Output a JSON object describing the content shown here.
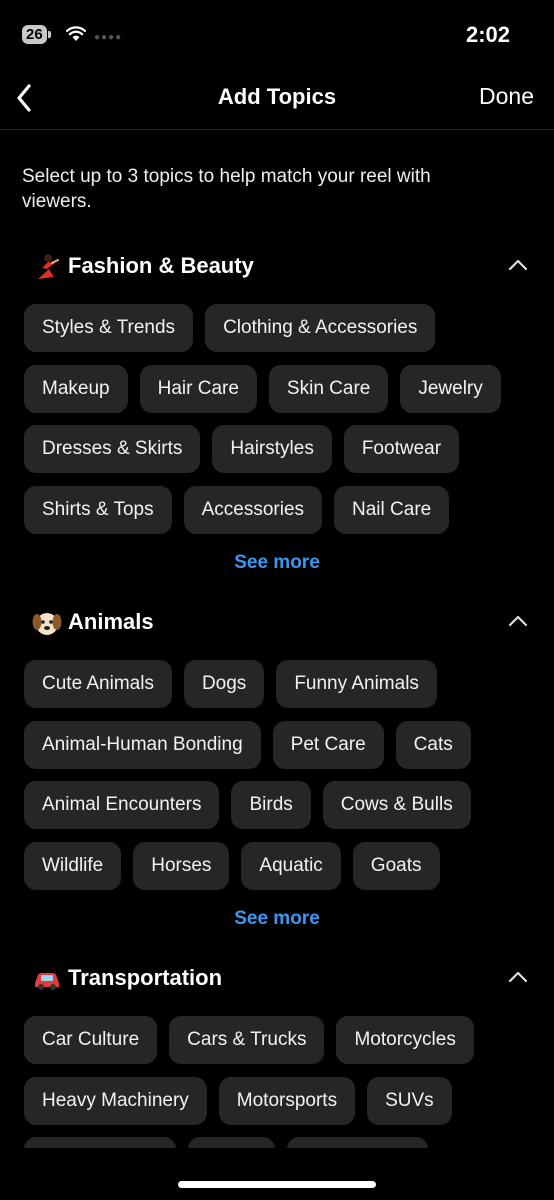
{
  "status_bar": {
    "battery": "26",
    "time": "2:02"
  },
  "header": {
    "title": "Add Topics",
    "done_label": "Done"
  },
  "intro_text": "Select up to 3 topics to help match your reel with viewers.",
  "sections": [
    {
      "title": "Fashion & Beauty",
      "emoji_icon": "dancer-icon",
      "rows": [
        [
          "Styles & Trends",
          "Clothing & Accessories"
        ],
        [
          "Makeup",
          "Hair Care",
          "Skin Care",
          "Jewelry"
        ],
        [
          "Dresses & Skirts",
          "Hairstyles",
          "Footwear"
        ],
        [
          "Shirts & Tops",
          "Accessories",
          "Nail Care"
        ]
      ],
      "see_more": "See more"
    },
    {
      "title": "Animals",
      "emoji_icon": "dog-face-icon",
      "rows": [
        [
          "Cute Animals",
          "Dogs",
          "Funny Animals"
        ],
        [
          "Animal-Human Bonding",
          "Pet Care",
          "Cats"
        ],
        [
          "Animal Encounters",
          "Birds",
          "Cows & Bulls"
        ],
        [
          "Wildlife",
          "Horses",
          "Aquatic",
          "Goats"
        ]
      ],
      "see_more": "See more"
    },
    {
      "title": "Transportation",
      "emoji_icon": "car-icon",
      "rows": [
        [
          "Car Culture",
          "Cars & Trucks",
          "Motorcycles"
        ],
        [
          "Heavy Machinery",
          "Motorsports",
          "SUVs"
        ]
      ]
    }
  ],
  "colors": {
    "background": "#000000",
    "chip": "#262626",
    "link": "#3d97f0",
    "text": "#ffffff"
  }
}
